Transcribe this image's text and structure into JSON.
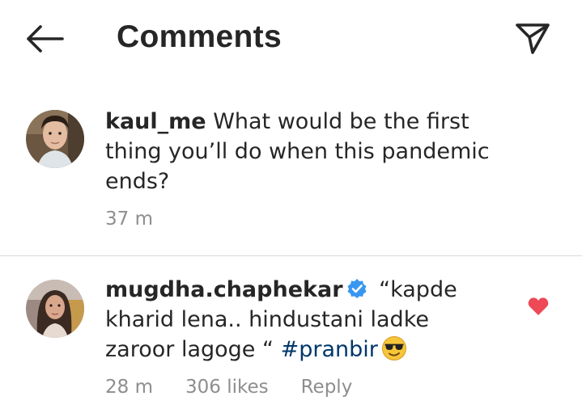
{
  "header": {
    "title": "Comments",
    "back_icon": "arrow-left-icon",
    "share_icon": "paper-plane-icon"
  },
  "caption": {
    "username": "kaul_me",
    "text": "What would be the first thing you’ll do when this pandemic ends?",
    "time": "37 m"
  },
  "comments": [
    {
      "username": "mugdha.chaphekar",
      "verified": true,
      "text": "“kapde kharid lena.. hindustani ladke zaroor lagoge “",
      "hashtag": "#pranbir",
      "emoji": "smiling-face-with-sunglasses",
      "time": "28 m",
      "likes": "306 likes",
      "reply_label": "Reply",
      "liked": true
    }
  ],
  "colors": {
    "text": "#262626",
    "meta": "#8e8e8e",
    "hashtag": "#00376b",
    "verified": "#3897f0",
    "heart": "#ed4956",
    "divider": "#dbdbdb"
  }
}
